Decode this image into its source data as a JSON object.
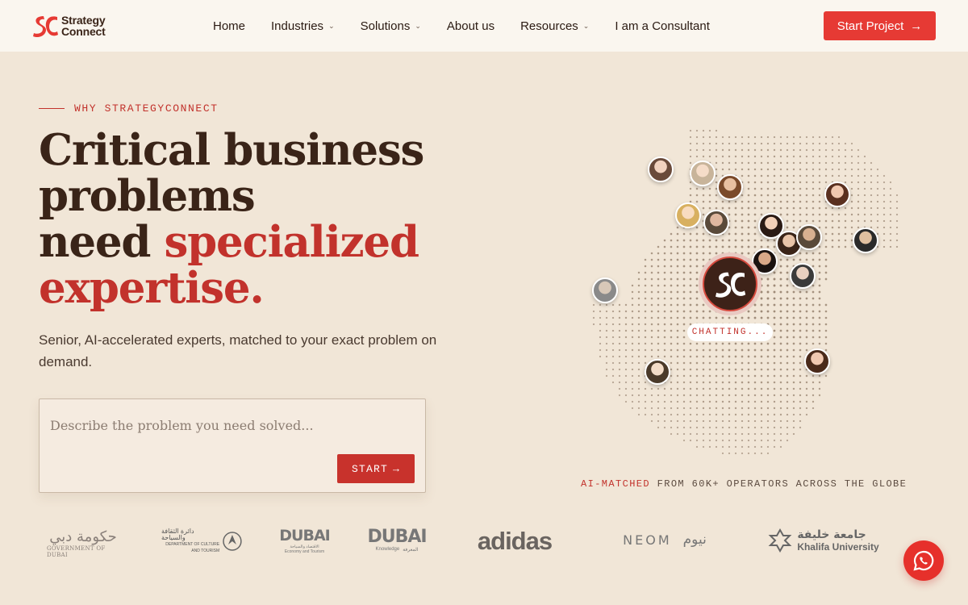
{
  "brand": {
    "name_line1": "Strategy",
    "name_line2": "Connect",
    "accent_color": "#e63a34",
    "dark_color": "#3a2418"
  },
  "nav": {
    "items": [
      {
        "label": "Home",
        "has_dropdown": false
      },
      {
        "label": "Industries",
        "has_dropdown": true
      },
      {
        "label": "Solutions",
        "has_dropdown": true
      },
      {
        "label": "About us",
        "has_dropdown": false
      },
      {
        "label": "Resources",
        "has_dropdown": true
      },
      {
        "label": "I am a Consultant",
        "has_dropdown": false
      }
    ],
    "cta_label": "Start Project",
    "cta_arrow": "→"
  },
  "hero": {
    "eyebrow": "WHY STRATEGYCONNECT",
    "headline_line1": "Critical business",
    "headline_line2": "problems",
    "headline_line3_plain": "need ",
    "headline_line3_accent": "specialized",
    "headline_line4_accent": "expertise.",
    "subtitle": "Senior, AI-accelerated experts, matched to your exact problem on demand.",
    "input_placeholder": "Describe the problem you need solved...",
    "input_value": "",
    "start_label": "START",
    "start_arrow": "→"
  },
  "globe": {
    "center_logo": "SC",
    "chat_status": "CHATTING...",
    "caption_highlight": "AI-MATCHED",
    "caption_rest": " FROM 60K+ OPERATORS ACROSS THE GLOBE"
  },
  "client_logos": {
    "gov_dubai": {
      "arabic": "حكومة دبي",
      "english": "GOVERNMENT OF DUBAI"
    },
    "dct": {
      "arabic": "دائرة الثقافة والسياحة",
      "english_line1": "DEPARTMENT OF CULTURE",
      "english_line2": "AND TOURISM"
    },
    "dubai_economy": {
      "wordmark": "DUBAI",
      "sub": "Economy and Tourism",
      "sub_arabic": "الاقتصاد والسياحة"
    },
    "dubai_knowledge": {
      "wordmark": "DUBAI",
      "sub": "Knowledge",
      "sub_arabic": "المعرفة"
    },
    "adidas": {
      "wordmark": "adidas"
    },
    "neom": {
      "wordmark": "NEOM",
      "arabic": "نيوم"
    },
    "khalifa": {
      "arabic": "جامعة خليفة",
      "english": "Khalifa University"
    }
  },
  "icons": {
    "whatsapp": "whatsapp-icon",
    "dropdown": "chevron-down-icon"
  }
}
